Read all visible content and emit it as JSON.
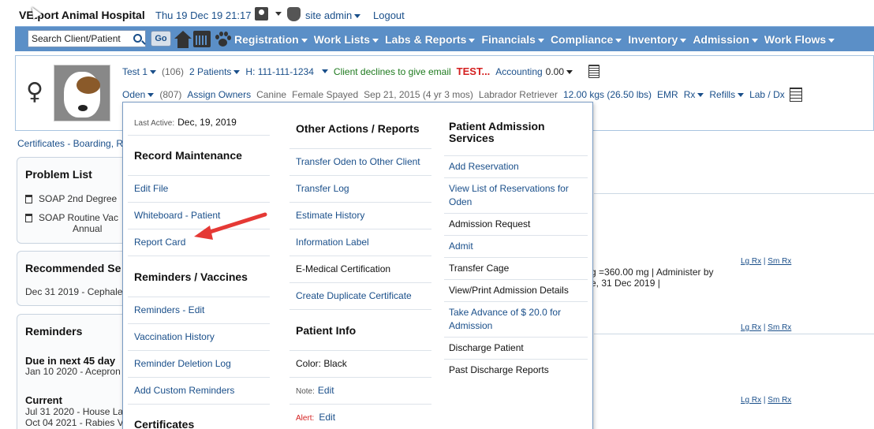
{
  "header": {
    "hospital_name": "VEtport Animal Hospital",
    "datetime": "Thu 19 Dec 19 21:17",
    "user_label": "site admin",
    "logout_label": "Logout"
  },
  "nav": {
    "search_placeholder": "Search Client/Patient",
    "go_label": "Go",
    "menus": [
      "Registration",
      "Work Lists",
      "Labs & Reports",
      "Financials",
      "Compliance",
      "Inventory",
      "Admission",
      "Work Flows"
    ]
  },
  "client_row": {
    "client_name": "Test 1",
    "client_id": "(106)",
    "patients_label": "2  Patients",
    "phone": "H: 111-111-1234",
    "declines_email": "Client declines to give email",
    "test_flag": "TEST...",
    "accounting_label": "Accounting",
    "accounting_value": "0.00"
  },
  "patient_row": {
    "name": "Oden",
    "id": "(807)",
    "assign_owners": "Assign Owners",
    "species": "Canine",
    "sex": "Female Spayed",
    "dob": "Sep 21, 2015 (4 yr 3 mos)",
    "breed": "Labrador Retriever",
    "weight": "12.00 kgs (26.50 lbs)",
    "emr": "EMR",
    "rx": "Rx",
    "refills": "Refills",
    "lab_dx": "Lab / Dx"
  },
  "background": {
    "certs_line": "Certificates - Boarding, R",
    "problem_list_title": "Problem List",
    "problem_1": "SOAP   2nd Degree",
    "problem_2a": "SOAP   Routine Vac",
    "problem_2b": "Annual",
    "recommended_title": "Recommended Se",
    "recommended_item": "Dec 31 2019 - Cephale",
    "reminders_title": "Reminders",
    "due_title": "Due in next 45 day",
    "due_item": "Jan 10 2020 - Acepron",
    "current_title": "Current",
    "current_1": "Jul 31 2020 - House La",
    "current_2": "Oct 04 2021 - Rabies V",
    "rx_text_1": "g =360.00 mg | Administer by",
    "rx_text_2": "e, 31 Dec 2019 |",
    "lg_rx": "Lg Rx",
    "sm_rx": "Sm Rx",
    "sep": "|"
  },
  "dropdown": {
    "last_active_label": "Last Active:",
    "last_active_value": "Dec, 19, 2019",
    "record_maintenance_heading": "Record Maintenance",
    "edit_file": "Edit File",
    "whiteboard": "Whiteboard - Patient",
    "report_card": "Report Card",
    "reminders_vaccines_heading": "Reminders / Vaccines",
    "reminders_edit": "Reminders - Edit",
    "vaccination_history": "Vaccination History",
    "reminder_deletion_log": "Reminder Deletion Log",
    "add_custom_reminders": "Add Custom Reminders",
    "certificates_heading": "Certificates",
    "other_actions_heading": "Other Actions / Reports",
    "transfer_oden": "Transfer Oden to Other Client",
    "transfer_log": "Transfer Log",
    "estimate_history": "Estimate History",
    "information_label": "Information Label",
    "e_medical": "E-Medical Certification",
    "create_duplicate": "Create Duplicate Certificate",
    "patient_info_heading": "Patient Info",
    "color_label": "Color: Black",
    "note_label": "Note:",
    "note_edit": "Edit",
    "alert_label": "Alert:",
    "alert_edit": "Edit",
    "admission_heading_1": "Patient Admission",
    "admission_heading_2": "Services",
    "add_reservation": "Add Reservation",
    "view_reservations_1": "View List of Reservations for",
    "view_reservations_2": "Oden",
    "admission_request": "Admission Request",
    "admit": "Admit",
    "transfer_cage": "Transfer Cage",
    "view_print_admission": "View/Print Admission Details",
    "take_advance_1": "Take Advance of $ 20.0 for",
    "take_advance_2": "Admission",
    "discharge_patient": "Discharge Patient",
    "past_discharge": "Past Discharge Reports"
  },
  "colors": {
    "nav_bg": "#5b8fc7",
    "link": "#1a4f8a",
    "alert_red": "#d42020",
    "arrow_red": "#e53935"
  }
}
